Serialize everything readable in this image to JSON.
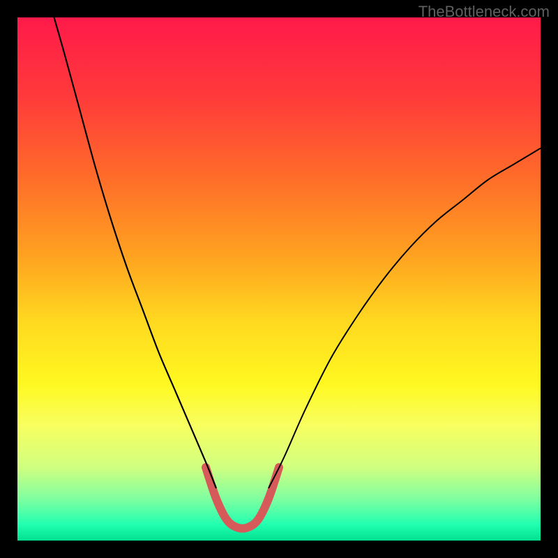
{
  "watermark": "TheBottleneck.com",
  "chart_data": {
    "type": "line",
    "title": "",
    "xlabel": "",
    "ylabel": "",
    "xlim": [
      0,
      100
    ],
    "ylim": [
      0,
      100
    ],
    "background_gradient": {
      "stops": [
        {
          "pos": 0.0,
          "color": "#ff1a4a"
        },
        {
          "pos": 0.15,
          "color": "#ff3a3a"
        },
        {
          "pos": 0.3,
          "color": "#ff6a2a"
        },
        {
          "pos": 0.45,
          "color": "#ffa020"
        },
        {
          "pos": 0.58,
          "color": "#ffd820"
        },
        {
          "pos": 0.7,
          "color": "#fff820"
        },
        {
          "pos": 0.78,
          "color": "#f8ff60"
        },
        {
          "pos": 0.86,
          "color": "#d0ff80"
        },
        {
          "pos": 0.92,
          "color": "#80ffa0"
        },
        {
          "pos": 0.97,
          "color": "#20ffb0"
        },
        {
          "pos": 1.0,
          "color": "#00e090"
        }
      ]
    },
    "series": [
      {
        "name": "left-curve",
        "stroke": "#000000",
        "stroke_width": 2.2,
        "points": [
          {
            "x": 7,
            "y": 100
          },
          {
            "x": 9,
            "y": 93
          },
          {
            "x": 12,
            "y": 82
          },
          {
            "x": 15,
            "y": 71
          },
          {
            "x": 18,
            "y": 61
          },
          {
            "x": 21,
            "y": 52
          },
          {
            "x": 24,
            "y": 44
          },
          {
            "x": 27,
            "y": 36
          },
          {
            "x": 30,
            "y": 29
          },
          {
            "x": 33,
            "y": 22
          },
          {
            "x": 36,
            "y": 15
          },
          {
            "x": 38,
            "y": 10
          }
        ]
      },
      {
        "name": "right-curve",
        "stroke": "#000000",
        "stroke_width": 2.0,
        "points": [
          {
            "x": 48,
            "y": 10
          },
          {
            "x": 51,
            "y": 16
          },
          {
            "x": 55,
            "y": 25
          },
          {
            "x": 60,
            "y": 35
          },
          {
            "x": 65,
            "y": 43
          },
          {
            "x": 70,
            "y": 50
          },
          {
            "x": 75,
            "y": 56
          },
          {
            "x": 80,
            "y": 61
          },
          {
            "x": 85,
            "y": 65
          },
          {
            "x": 90,
            "y": 69
          },
          {
            "x": 95,
            "y": 72
          },
          {
            "x": 100,
            "y": 75
          }
        ]
      },
      {
        "name": "valley-highlight",
        "stroke": "#d65a5a",
        "stroke_width": 12,
        "linecap": "round",
        "points": [
          {
            "x": 36,
            "y": 14
          },
          {
            "x": 38,
            "y": 8
          },
          {
            "x": 40,
            "y": 4
          },
          {
            "x": 42,
            "y": 2.5
          },
          {
            "x": 44,
            "y": 2.5
          },
          {
            "x": 46,
            "y": 4
          },
          {
            "x": 48,
            "y": 8
          },
          {
            "x": 50,
            "y": 14
          }
        ]
      }
    ]
  }
}
